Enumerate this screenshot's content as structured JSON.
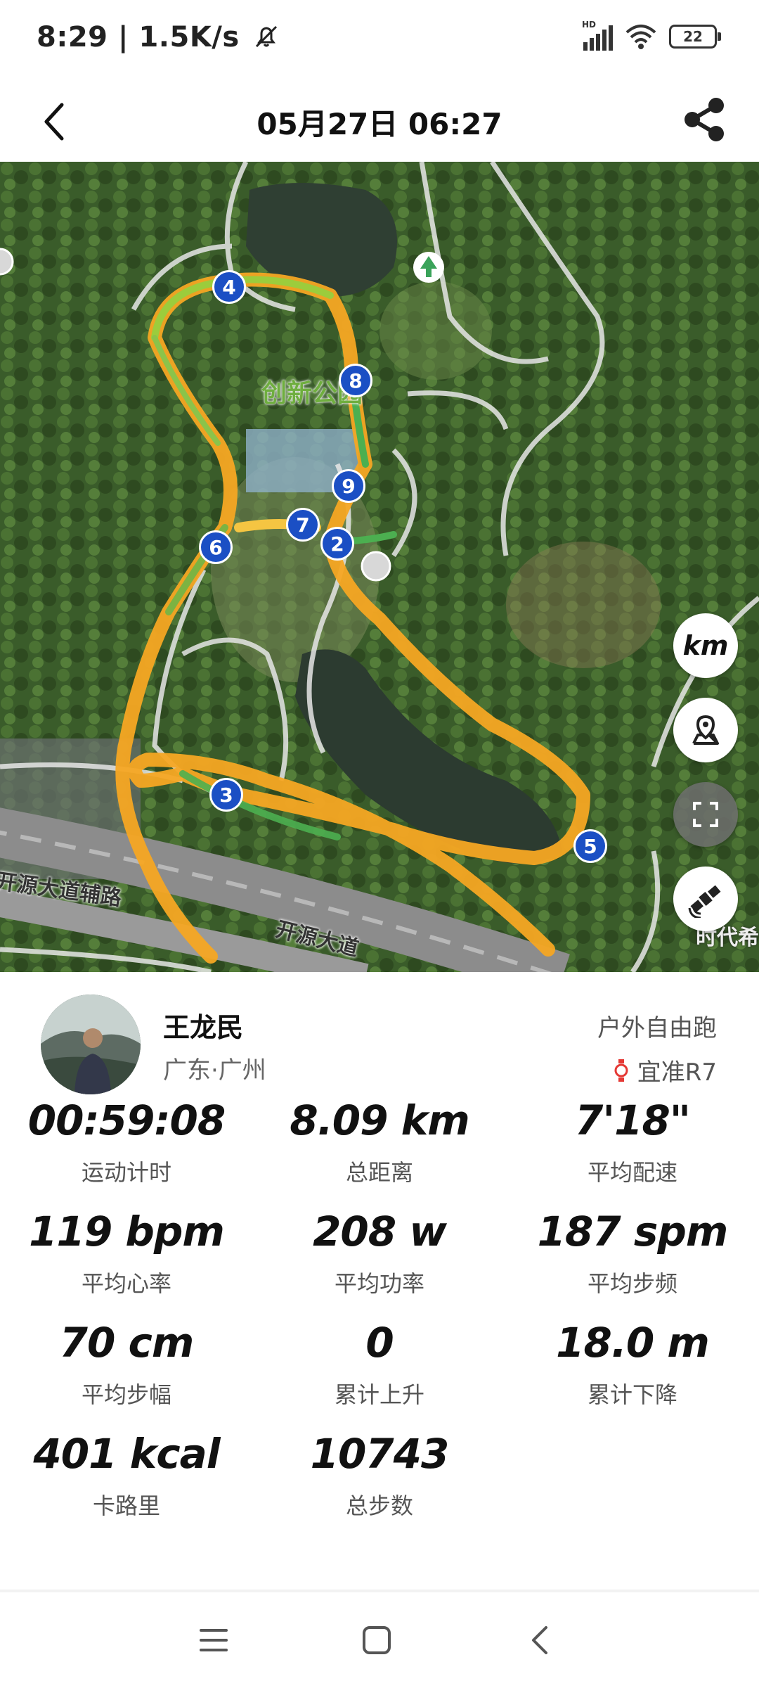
{
  "status_bar": {
    "time_speed": "8:29 | 1.5K/s",
    "network_label": "HD",
    "battery": "22"
  },
  "header": {
    "title": "05月27日 06:27"
  },
  "map": {
    "park_label": "创新公园",
    "road_label_1": "开源大道辅路",
    "road_label_2": "开源大道",
    "edge_label": "时代希",
    "km_button": "km",
    "markers": [
      "2",
      "3",
      "4",
      "5",
      "6",
      "7",
      "8",
      "9"
    ]
  },
  "profile": {
    "name": "王龙民",
    "location": "广东·广州",
    "activity_type": "户外自由跑",
    "device": "宜准R7"
  },
  "stats": [
    {
      "value": "00:59:08",
      "label": "运动计时"
    },
    {
      "value": "8.09 km",
      "label": "总距离"
    },
    {
      "value": "7'18\"",
      "label": "平均配速"
    },
    {
      "value": "119 bpm",
      "label": "平均心率"
    },
    {
      "value": "208 w",
      "label": "平均功率"
    },
    {
      "value": "187 spm",
      "label": "平均步频"
    },
    {
      "value": "70 cm",
      "label": "平均步幅"
    },
    {
      "value": "0",
      "label": "累计上升"
    },
    {
      "value": "18.0 m",
      "label": "累计下降"
    },
    {
      "value": "401 kcal",
      "label": "卡路里"
    },
    {
      "value": "10743",
      "label": "总步数"
    }
  ],
  "colors": {
    "route_orange": "#f5a623",
    "route_green": "#4caf50",
    "marker_blue": "#1b4fc4",
    "device_icon_red": "#e53935"
  }
}
